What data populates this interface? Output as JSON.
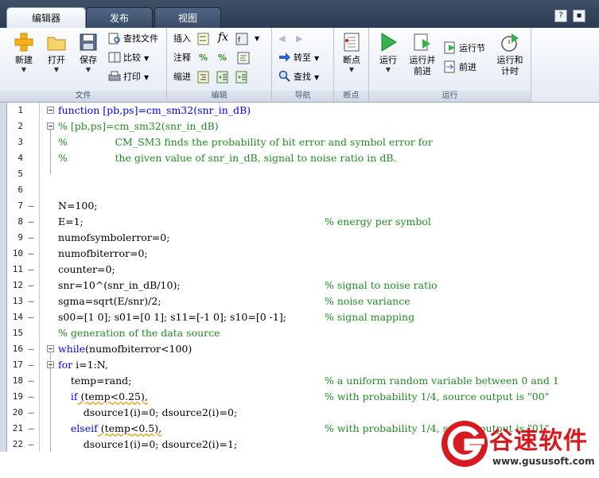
{
  "tabs": [
    "编辑器",
    "发布",
    "视图"
  ],
  "ribbon": {
    "file": {
      "label": "文件",
      "new": "新建",
      "open": "打开",
      "save": "保存",
      "find_files": "查找文件",
      "compare": "比较",
      "print": "打印"
    },
    "edit": {
      "label": "编辑",
      "insert": "插入",
      "comment": "注释",
      "indent": "缩进",
      "fx": "fx"
    },
    "navigate": {
      "label": "导航",
      "goto": "转至",
      "find": "查找"
    },
    "breakpoints": {
      "label": "断点",
      "button": "断点"
    },
    "run": {
      "label": "运行",
      "run": "运行",
      "run_advance_1": "运行并",
      "run_advance_2": "前进",
      "run_section": "运行节",
      "advance": "前进",
      "run_time_1": "运行和",
      "run_time_2": "计时"
    }
  },
  "colors": {
    "keyword": "#0000ff",
    "comment": "#228b22",
    "watermark": "#d71920"
  },
  "code_lines": [
    {
      "n": "1",
      "bp": "",
      "code": "function [pb,ps]=cm_sm32(snr_in_dB)",
      "comment": ""
    },
    {
      "n": "2",
      "bp": "",
      "code": "% [pb,ps]=cm_sm32(snr_in_dB)",
      "comment": ""
    },
    {
      "n": "3",
      "bp": "",
      "code": "%               CM_SM3 finds the probability of bit error and symbol error for",
      "comment": ""
    },
    {
      "n": "4",
      "bp": "",
      "code": "%               the given value of snr_in_dB, signal to noise ratio in dB.",
      "comment": ""
    },
    {
      "n": "5",
      "bp": "",
      "code": "",
      "comment": ""
    },
    {
      "n": "6",
      "bp": "",
      "code": "",
      "comment": ""
    },
    {
      "n": "7",
      "bp": "–",
      "code": "N=100;",
      "comment": ""
    },
    {
      "n": "8",
      "bp": "–",
      "code": "E=1;",
      "comment": "% energy per symbol"
    },
    {
      "n": "9",
      "bp": "–",
      "code": "numofsymbolerror=0;",
      "comment": ""
    },
    {
      "n": "10",
      "bp": "–",
      "code": "numofbiterror=0;",
      "comment": ""
    },
    {
      "n": "11",
      "bp": "–",
      "code": "counter=0;",
      "comment": ""
    },
    {
      "n": "12",
      "bp": "–",
      "code": "snr=10^(snr_in_dB/10);",
      "comment": "% signal to noise ratio"
    },
    {
      "n": "13",
      "bp": "–",
      "code": "sgma=sqrt(E/snr)/2;",
      "comment": "% noise variance"
    },
    {
      "n": "14",
      "bp": "–",
      "code": "s00=[1 0]; s01=[0 1]; s11=[-1 0]; s10=[0 -1];",
      "comment": "% signal mapping"
    },
    {
      "n": "15",
      "bp": "",
      "code": "% generation of the data source",
      "comment": ""
    },
    {
      "n": "16",
      "bp": "–",
      "kw": "while",
      "code": "(numofbiterror<100)",
      "comment": ""
    },
    {
      "n": "17",
      "bp": "–",
      "kw": "for",
      "code": " i=1:N,",
      "comment": ""
    },
    {
      "n": "18",
      "bp": "–",
      "code": "    temp=rand;",
      "comment": "% a uniform random variable between 0 and 1"
    },
    {
      "n": "19",
      "bp": "–",
      "kw": "    if",
      "code": " (temp<0.25),",
      "comment": "% with probability 1/4, source output is \"00\""
    },
    {
      "n": "20",
      "bp": "–",
      "code": "        dsource1(i)=0; dsource2(i)=0;",
      "comment": ""
    },
    {
      "n": "21",
      "bp": "–",
      "kw": "    elseif",
      "code": " (temp<0.5),",
      "comment": "% with probability 1/4, source output is \"01\""
    },
    {
      "n": "22",
      "bp": "–",
      "code": "        dsource1(i)=0; dsource2(i)=1;",
      "comment": ""
    }
  ],
  "watermark": {
    "name": "谷速软件",
    "url": "www.gususoft.com"
  }
}
